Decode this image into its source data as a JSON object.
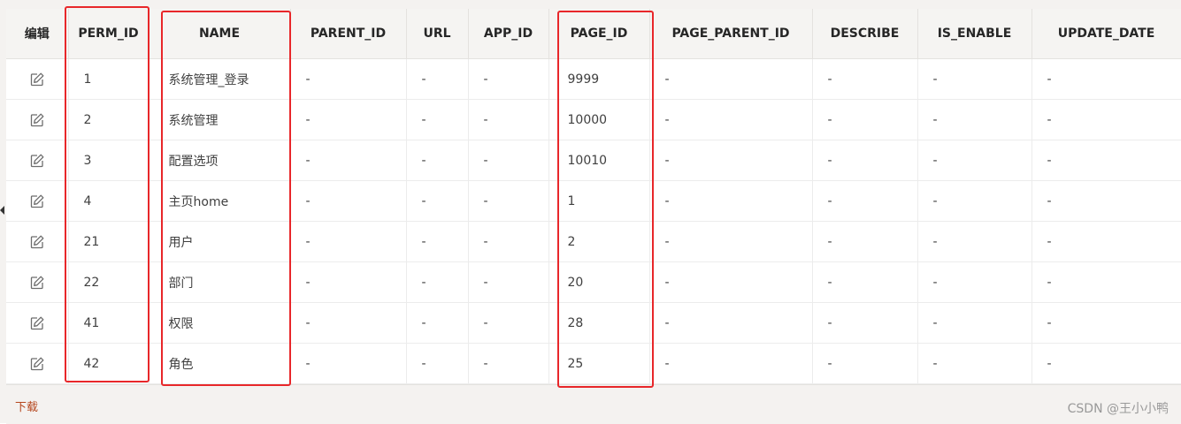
{
  "grid": {
    "columns": [
      "编辑",
      "PERM_ID",
      "NAME",
      "PARENT_ID",
      "URL",
      "APP_ID",
      "PAGE_ID",
      "PAGE_PARENT_ID",
      "DESCRIBE",
      "IS_ENABLE",
      "UPDATE_DATE"
    ],
    "rows": [
      {
        "perm_id": "1",
        "name": "系统管理_登录",
        "parent_id": "-",
        "url": "-",
        "app_id": "-",
        "page_id": "9999",
        "page_parent_id": "-",
        "describe": "-",
        "is_enable": "-",
        "update_date": "-"
      },
      {
        "perm_id": "2",
        "name": "系统管理",
        "parent_id": "-",
        "url": "-",
        "app_id": "-",
        "page_id": "10000",
        "page_parent_id": "-",
        "describe": "-",
        "is_enable": "-",
        "update_date": "-"
      },
      {
        "perm_id": "3",
        "name": "配置选项",
        "parent_id": "-",
        "url": "-",
        "app_id": "-",
        "page_id": "10010",
        "page_parent_id": "-",
        "describe": "-",
        "is_enable": "-",
        "update_date": "-"
      },
      {
        "perm_id": "4",
        "name": "主页home",
        "parent_id": "-",
        "url": "-",
        "app_id": "-",
        "page_id": "1",
        "page_parent_id": "-",
        "describe": "-",
        "is_enable": "-",
        "update_date": "-"
      },
      {
        "perm_id": "21",
        "name": "用户",
        "parent_id": "-",
        "url": "-",
        "app_id": "-",
        "page_id": "2",
        "page_parent_id": "-",
        "describe": "-",
        "is_enable": "-",
        "update_date": "-"
      },
      {
        "perm_id": "22",
        "name": "部门",
        "parent_id": "-",
        "url": "-",
        "app_id": "-",
        "page_id": "20",
        "page_parent_id": "-",
        "describe": "-",
        "is_enable": "-",
        "update_date": "-"
      },
      {
        "perm_id": "41",
        "name": "权限",
        "parent_id": "-",
        "url": "-",
        "app_id": "-",
        "page_id": "28",
        "page_parent_id": "-",
        "describe": "-",
        "is_enable": "-",
        "update_date": "-"
      },
      {
        "perm_id": "42",
        "name": "角色",
        "parent_id": "-",
        "url": "-",
        "app_id": "-",
        "page_id": "25",
        "page_parent_id": "-",
        "describe": "-",
        "is_enable": "-",
        "update_date": "-"
      }
    ]
  },
  "footer": {
    "download_label": "下载",
    "watermark": "CSDN @王小小鸭"
  },
  "icons": {
    "row_edit": "edit-pencil-icon"
  },
  "colors": {
    "highlight": "#e8272a",
    "link": "#b5461d",
    "header_bg": "#f5f4f2"
  }
}
